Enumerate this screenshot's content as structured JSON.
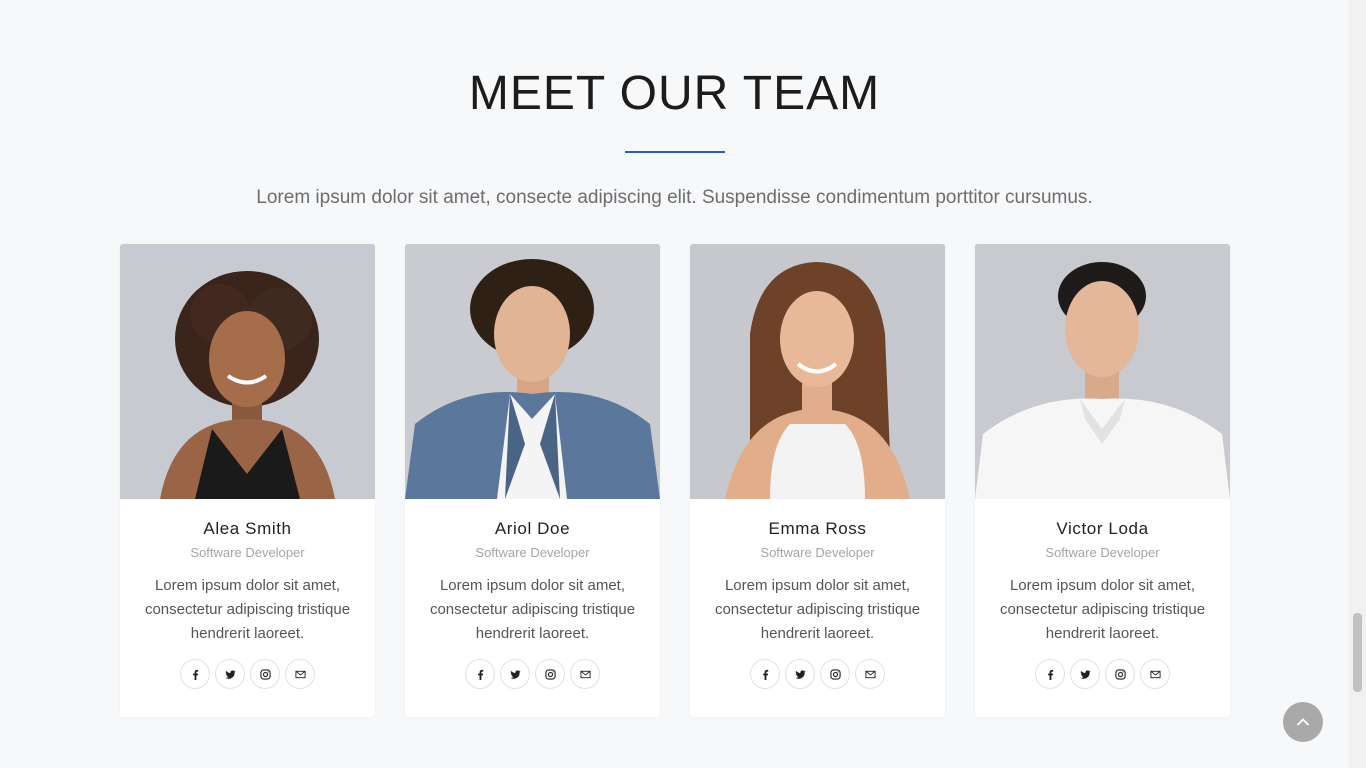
{
  "section": {
    "title": "MEET OUR TEAM",
    "subtitle": "Lorem ipsum dolor sit amet, consecte adipiscing elit. Suspendisse condimentum porttitor cursumus.",
    "accent_color": "#2d5bd6"
  },
  "team": [
    {
      "name": "Alea Smith",
      "role": "Software Developer",
      "bio": "Lorem ipsum dolor sit amet, consectetur adipiscing tristique hendrerit laoreet.",
      "photo": "portrait-woman-curly-hair"
    },
    {
      "name": "Ariol Doe",
      "role": "Software Developer",
      "bio": "Lorem ipsum dolor sit amet, consectetur adipiscing tristique hendrerit laoreet.",
      "photo": "portrait-man-curly-hair-blazer"
    },
    {
      "name": "Emma Ross",
      "role": "Software Developer",
      "bio": "Lorem ipsum dolor sit amet, consectetur adipiscing tristique hendrerit laoreet.",
      "photo": "portrait-woman-long-hair"
    },
    {
      "name": "Victor Loda",
      "role": "Software Developer",
      "bio": "Lorem ipsum dolor sit amet, consectetur adipiscing tristique hendrerit laoreet.",
      "photo": "portrait-man-white-shirt"
    }
  ],
  "social_icons": [
    "facebook-icon",
    "twitter-icon",
    "instagram-icon",
    "envelope-icon"
  ],
  "back_to_top": {
    "icon": "chevron-up-icon"
  }
}
